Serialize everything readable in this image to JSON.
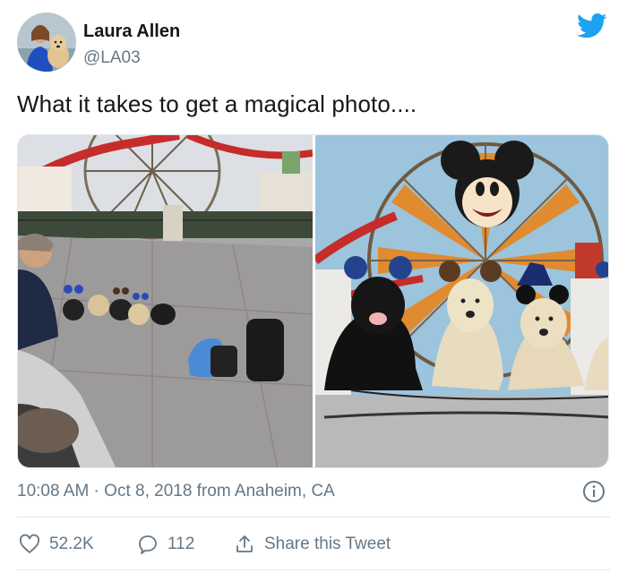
{
  "author": {
    "name": "Laura Allen",
    "handle": "@LA03"
  },
  "tweet": {
    "text": "What it takes to get a magical photo...."
  },
  "meta": {
    "timestamp": "10:08 AM · Oct 8, 2018 from Anaheim, CA"
  },
  "actions": {
    "likes": "52.2K",
    "replies": "112",
    "share_label": "Share this Tweet"
  },
  "icons": {
    "brand": "twitter-bird-icon",
    "info": "info-icon",
    "like": "heart-icon",
    "reply": "reply-bubble-icon",
    "share": "share-upload-icon"
  },
  "colors": {
    "brand_blue": "#1da1f2",
    "text_primary": "#14171a",
    "text_secondary": "#657786",
    "divider": "#e1e8ed"
  }
}
